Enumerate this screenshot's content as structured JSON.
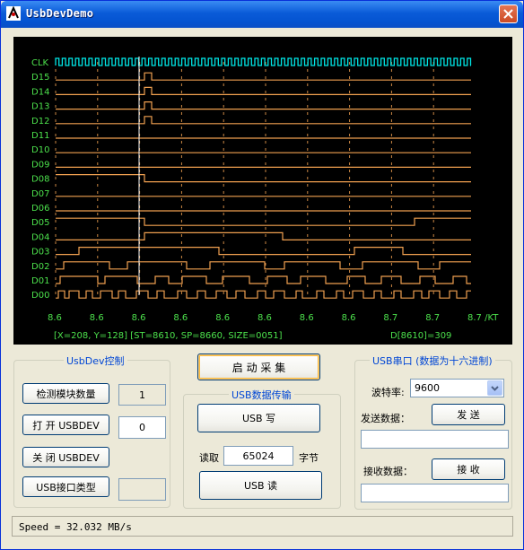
{
  "window": {
    "title": "UsbDevDemo"
  },
  "scope": {
    "channels": [
      "CLK",
      "D15",
      "D14",
      "D13",
      "D12",
      "D11",
      "D10",
      "D09",
      "D08",
      "D07",
      "D06",
      "D05",
      "D04",
      "D03",
      "D02",
      "D01",
      "D00"
    ],
    "x_ticks": [
      "8.6",
      "8.6",
      "8.6",
      "8.6",
      "8.6",
      "8.6",
      "8.6",
      "8.6",
      "8.7",
      "8.7",
      "8.7 /KT"
    ],
    "cursor_info": "[X=208, Y=128] [ST=8610, SP=8660, SIZE=0051]",
    "data_readout": "D[8610]=309",
    "colors": {
      "clk": "#00E5E5",
      "data": "#F0A050",
      "text": "#4CE14C",
      "cursor": "#FFFFFF",
      "grid": "#F0A050"
    }
  },
  "usbdev_group": {
    "title": "UsbDev控制",
    "detect_btn": "检测模块数量",
    "detect_value": "1",
    "open_btn": "打 开 USBDEV",
    "open_value": "0",
    "close_btn": "关 闭 USBDEV",
    "type_btn": "USB接口类型",
    "type_value": ""
  },
  "start_btn": "启 动 采 集",
  "transfer_group": {
    "title": "USB数据传输",
    "write_btn": "USB 写",
    "read_label": "读取",
    "read_value": "65024",
    "unit_label": "字节",
    "read_btn": "USB 读"
  },
  "serial_group": {
    "title": "USB串口 (数据为十六进制)",
    "baud_label": "波特率:",
    "baud_value": "9600",
    "send_label": "发送数据：",
    "send_btn": "发 送",
    "send_value": "",
    "recv_label": "接收数据：",
    "recv_btn": "接 收",
    "recv_value": ""
  },
  "status": {
    "text": "Speed = 32.032 MB/s"
  }
}
